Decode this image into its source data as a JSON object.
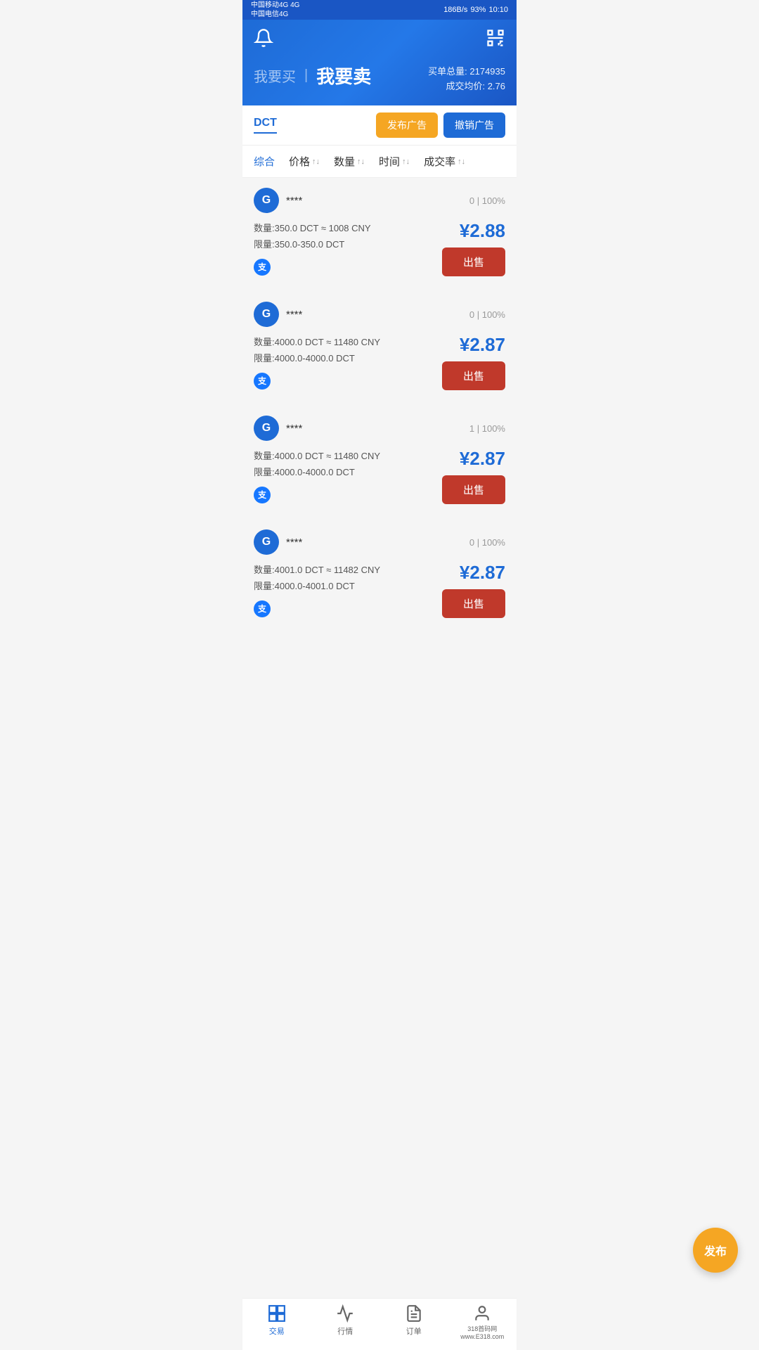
{
  "statusBar": {
    "leftTop": "中国移动4G 4G",
    "leftBottom": "中国电信4G",
    "signal": "186B/s",
    "battery": "93%",
    "time": "10:10"
  },
  "header": {
    "tabBuy": "我要买",
    "tabSell": "我要卖",
    "divider": "|",
    "totalOrderLabel": "买单总量:",
    "totalOrderValue": "2174935",
    "avgPriceLabel": "成交均价:",
    "avgPriceValue": "2.76"
  },
  "tokenBar": {
    "tokenName": "DCT",
    "publishBtn": "发布广告",
    "cancelBtn": "撤销广告"
  },
  "sortBar": {
    "items": [
      {
        "label": "综合",
        "hasArrow": false
      },
      {
        "label": "价格",
        "hasArrow": true
      },
      {
        "label": "数量",
        "hasArrow": true
      },
      {
        "label": "时间",
        "hasArrow": true
      },
      {
        "label": "成交率",
        "hasArrow": true
      }
    ]
  },
  "trades": [
    {
      "id": 1,
      "avatarLetter": "G",
      "traderName": "****",
      "stats": "0 | 100%",
      "quantityLabel": "数量:350.0 DCT ≈ 1008 CNY",
      "limitLabel": "限量:350.0-350.0 DCT",
      "price": "¥2.88",
      "sellBtn": "出售",
      "hasAlipay": true
    },
    {
      "id": 2,
      "avatarLetter": "G",
      "traderName": "****",
      "stats": "0 | 100%",
      "quantityLabel": "数量:4000.0 DCT ≈ 11480 CNY",
      "limitLabel": "限量:4000.0-4000.0 DCT",
      "price": "¥2.87",
      "sellBtn": "出售",
      "hasAlipay": true
    },
    {
      "id": 3,
      "avatarLetter": "G",
      "traderName": "****",
      "stats": "1 | 100%",
      "quantityLabel": "数量:4000.0 DCT ≈ 11480 CNY",
      "limitLabel": "限量:4000.0-4000.0 DCT",
      "price": "¥2.87",
      "sellBtn": "出售",
      "hasAlipay": true
    },
    {
      "id": 4,
      "avatarLetter": "G",
      "traderName": "****",
      "stats": "0 | 100%",
      "quantityLabel": "数量:4001.0 DCT ≈ 11482 CNY",
      "limitLabel": "限量:4000.0-4001.0 DCT",
      "price": "¥2.87",
      "sellBtn": "出售",
      "hasAlipay": true
    }
  ],
  "floatBtn": {
    "label": "发布"
  },
  "bottomNav": {
    "items": [
      {
        "id": "trade",
        "label": "交易",
        "active": true
      },
      {
        "id": "market",
        "label": "行情",
        "active": false
      },
      {
        "id": "order",
        "label": "订单",
        "active": false
      },
      {
        "id": "profile",
        "label": "318首码网\nwww.E318.com",
        "active": false
      }
    ]
  }
}
